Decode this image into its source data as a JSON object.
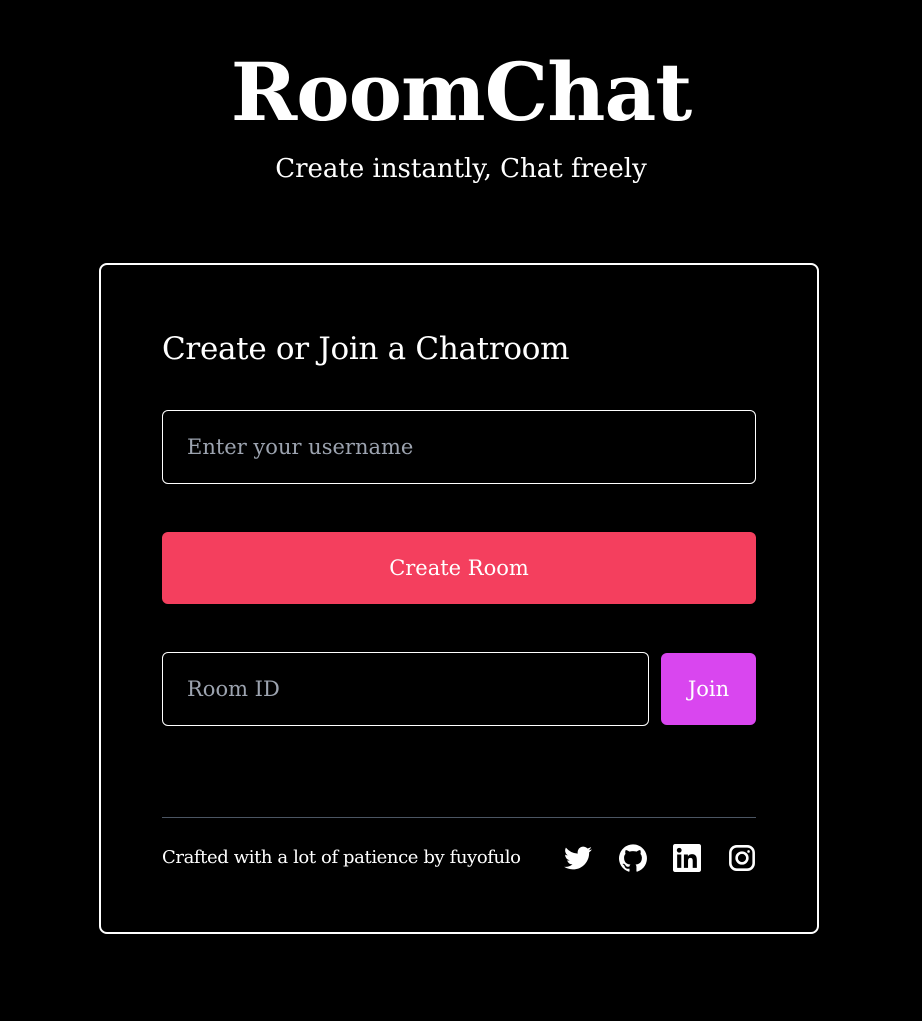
{
  "header": {
    "title": "RoomChat",
    "tagline": "Create instantly, Chat freely"
  },
  "card": {
    "heading": "Create or Join a Chatroom",
    "username_placeholder": "Enter your username",
    "username_value": "",
    "create_label": "Create Room",
    "room_placeholder": "Room ID",
    "room_value": "",
    "join_label": "Join"
  },
  "footer": {
    "credit": "Crafted with a lot of patience by fuyofulo",
    "socials": [
      {
        "icon": "twitter-icon"
      },
      {
        "icon": "github-icon"
      },
      {
        "icon": "linkedin-icon"
      },
      {
        "icon": "instagram-icon"
      }
    ]
  },
  "colors": {
    "background": "#000000",
    "create_button": "#f43f5e",
    "join_button": "#d946ef",
    "placeholder": "#9ca3af",
    "divider": "#4b5563"
  }
}
